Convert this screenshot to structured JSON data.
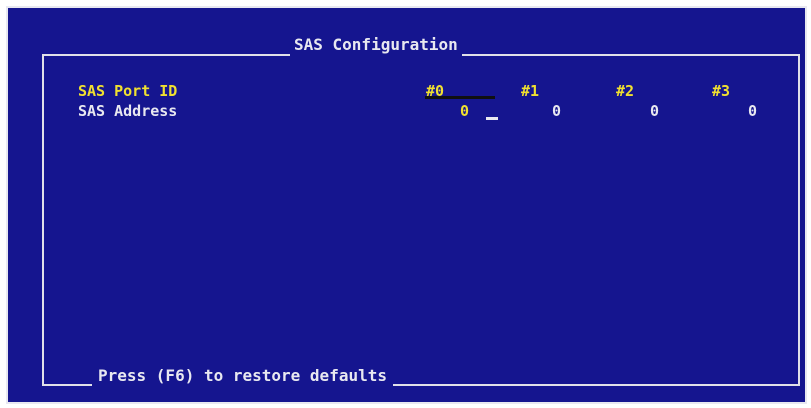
{
  "window": {
    "title": "SAS Configuration",
    "footer_hint": "Press (F6) to restore defaults"
  },
  "port_row": {
    "label": "SAS Port ID",
    "ports": [
      "#0",
      "#1",
      "#2",
      "#3"
    ]
  },
  "address_row": {
    "label": "SAS Address",
    "values": [
      "0",
      "0",
      "0",
      "0"
    ]
  },
  "colors": {
    "background": "#15158f",
    "text": "#e8e8f0",
    "highlight": "#f0e030"
  }
}
